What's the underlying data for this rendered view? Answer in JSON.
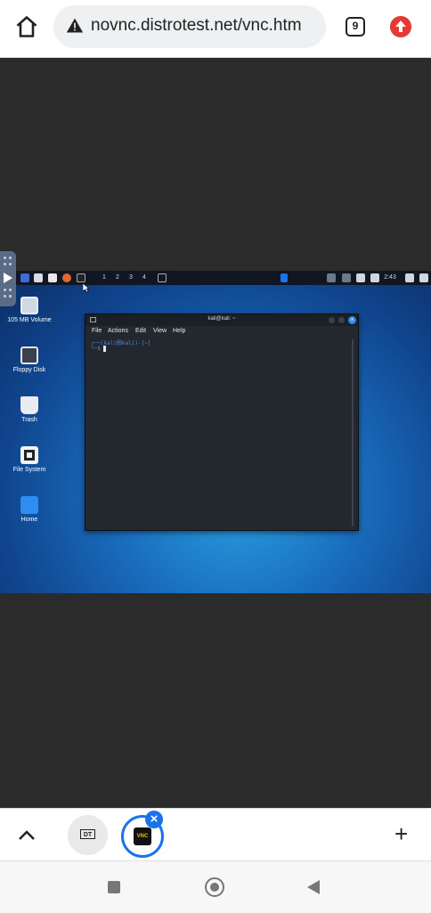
{
  "browser": {
    "url": "novnc.distrotest.net/vnc.htm",
    "tab_count": "9",
    "home_icon": "home-icon",
    "warning_icon": "not-secure-warning-icon",
    "upload_icon": "upload-icon"
  },
  "kali_panel": {
    "workspaces": [
      "1",
      "2",
      "3",
      "4"
    ],
    "clock": "2:43"
  },
  "desktop": {
    "icons": [
      {
        "label": "105 MB Volume",
        "icon": "drive-icon"
      },
      {
        "label": "Floppy Disk",
        "icon": "floppy-icon"
      },
      {
        "label": "Trash",
        "icon": "trash-icon"
      },
      {
        "label": "File System",
        "icon": "filesystem-icon"
      },
      {
        "label": "Home",
        "icon": "home-folder-icon"
      }
    ]
  },
  "terminal": {
    "title": "kali@kali: ~",
    "menu": [
      "File",
      "Actions",
      "Edit",
      "View",
      "Help"
    ],
    "prompt_line1": "┌──(kali㉿kali)-[~]",
    "prompt_line2": "└─$"
  },
  "tabstrip": {
    "dt_label": "DT",
    "vnc_label": "VNC",
    "close_label": "×",
    "new_tab_label": "+"
  },
  "colors": {
    "accent": "#1a73e8",
    "upload": "#e53935",
    "desktop_blue": "#1a6fc0"
  }
}
